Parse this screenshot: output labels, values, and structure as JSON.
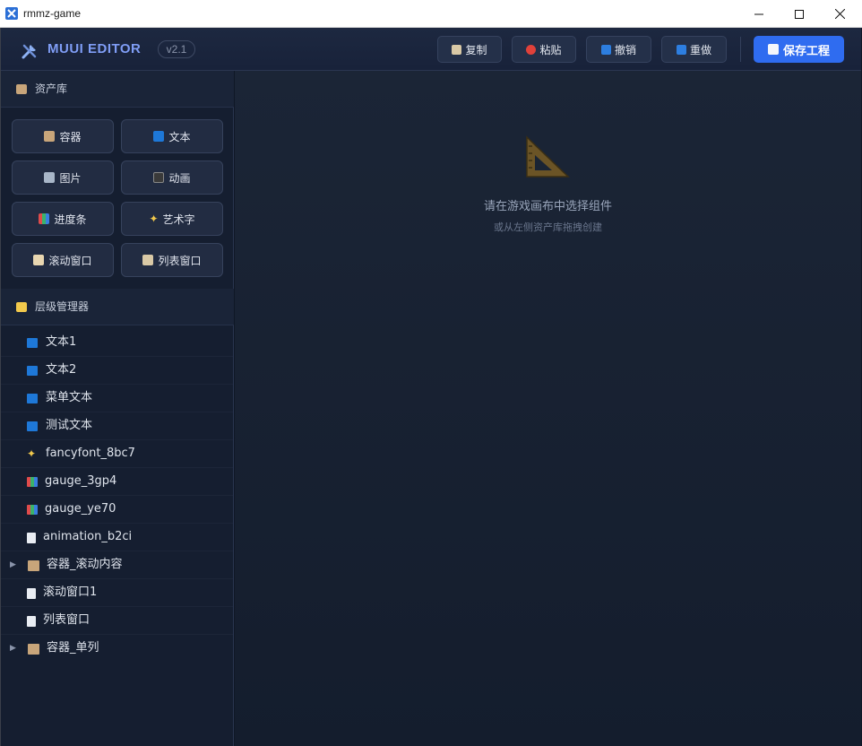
{
  "window": {
    "title": "rmmz-game"
  },
  "header": {
    "logo": "MUUI EDITOR",
    "version": "v2.1",
    "buttons": [
      {
        "label": "复制",
        "icon": "clipboard-icon"
      },
      {
        "label": "粘贴",
        "icon": "pin-icon"
      },
      {
        "label": "撤销",
        "icon": "undo-icon"
      },
      {
        "label": "重做",
        "icon": "redo-icon"
      }
    ],
    "save_label": "保存工程"
  },
  "assets": {
    "title": "资产库",
    "items": [
      {
        "label": "容器",
        "icon": "box-icon"
      },
      {
        "label": "文本",
        "icon": "text-icon"
      },
      {
        "label": "图片",
        "icon": "image-icon"
      },
      {
        "label": "动画",
        "icon": "clapper-icon"
      },
      {
        "label": "进度条",
        "icon": "bar-chart-icon"
      },
      {
        "label": "艺术字",
        "icon": "sparkle-icon"
      },
      {
        "label": "滚动窗口",
        "icon": "scroll-icon"
      },
      {
        "label": "列表窗口",
        "icon": "list-icon"
      }
    ]
  },
  "hierarchy": {
    "title": "层级管理器",
    "items": [
      {
        "label": "文本1",
        "icon": "text-icon",
        "expandable": false
      },
      {
        "label": "文本2",
        "icon": "text-icon",
        "expandable": false
      },
      {
        "label": "菜单文本",
        "icon": "text-icon",
        "expandable": false
      },
      {
        "label": "测试文本",
        "icon": "text-icon",
        "expandable": false
      },
      {
        "label": "fancyfont_8bc7",
        "icon": "sparkle-icon",
        "expandable": false
      },
      {
        "label": "gauge_3gp4",
        "icon": "bar-chart-icon",
        "expandable": false
      },
      {
        "label": "gauge_ye70",
        "icon": "bar-chart-icon",
        "expandable": false
      },
      {
        "label": "animation_b2ci",
        "icon": "page-icon",
        "expandable": false
      },
      {
        "label": "容器_滚动内容",
        "icon": "box-icon",
        "expandable": true
      },
      {
        "label": "滚动窗口1",
        "icon": "page-icon",
        "expandable": false
      },
      {
        "label": "列表窗口",
        "icon": "page-icon",
        "expandable": false
      },
      {
        "label": "容器_单列",
        "icon": "box-icon",
        "expandable": true
      }
    ]
  },
  "canvas": {
    "empty_title": "请在游戏画布中选择组件",
    "empty_subtitle": "或从左侧资产库拖拽创建"
  },
  "colors": {
    "accent": "#2f6cf0",
    "logo": "#7f9df5",
    "background": "#0f1726"
  }
}
